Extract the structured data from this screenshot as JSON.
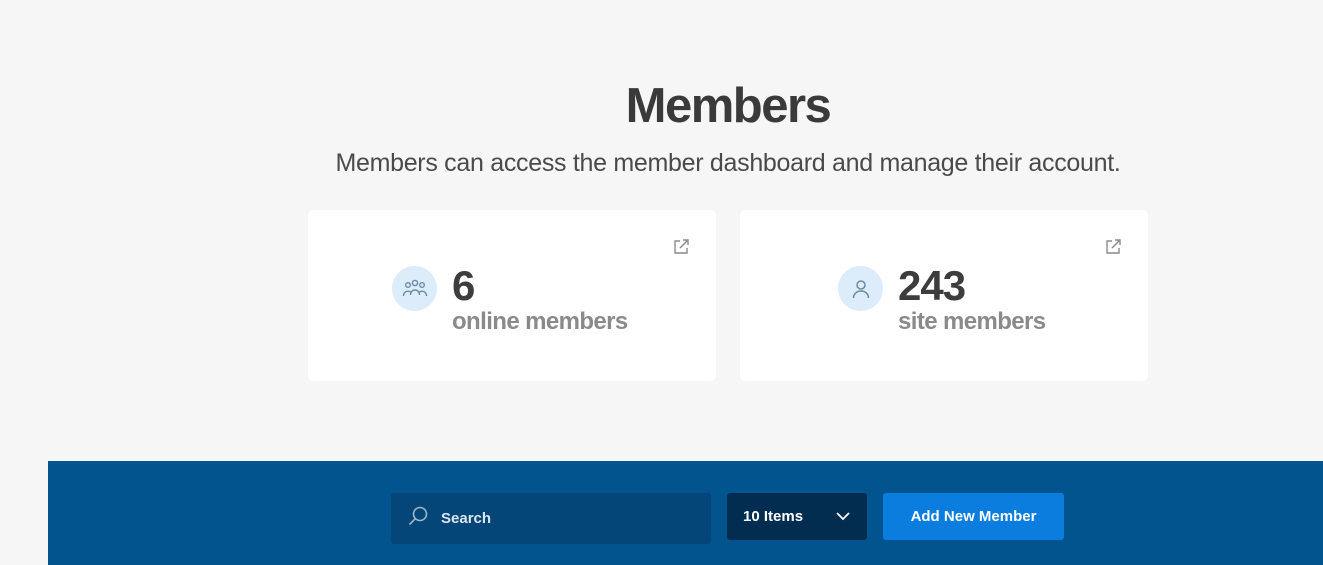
{
  "header": {
    "title": "Members",
    "subtitle": "Members can access the member dashboard and manage their account."
  },
  "stats": [
    {
      "count": "6",
      "label": "online members",
      "icon": "group-icon"
    },
    {
      "count": "243",
      "label": "site members",
      "icon": "user-icon"
    }
  ],
  "toolbar": {
    "search_placeholder": "Search",
    "items_select": "10 Items",
    "add_button": "Add New Member"
  },
  "colors": {
    "background": "#f6f6f6",
    "toolbar_bg": "#02548f",
    "search_bg": "#034677",
    "select_bg": "#032d50",
    "primary_button": "#0b7ddf",
    "avatar_bg": "#dcecfa"
  }
}
